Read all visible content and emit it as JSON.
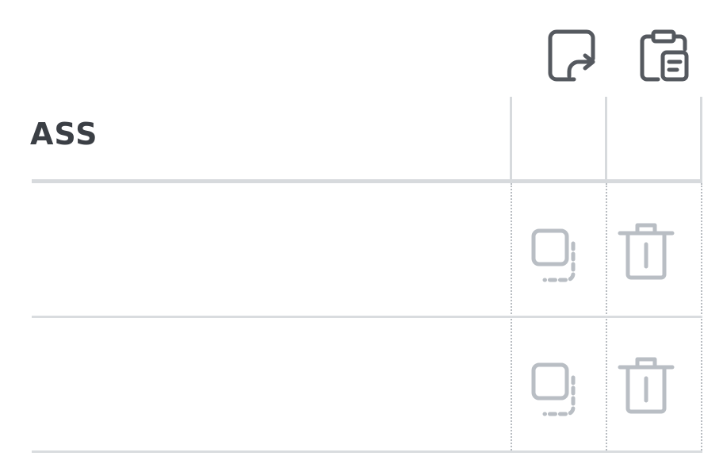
{
  "table": {
    "header_label": "ASS"
  },
  "icons": {
    "toolbar": [
      "export-icon",
      "clipboard-icon"
    ],
    "row_actions": [
      "duplicate-icon",
      "delete-icon"
    ]
  },
  "colors": {
    "toolbar_icon": "#55595f",
    "row_icon": "#b9bec4",
    "header_text": "#3b3f45",
    "divider": "#d7dadd"
  }
}
